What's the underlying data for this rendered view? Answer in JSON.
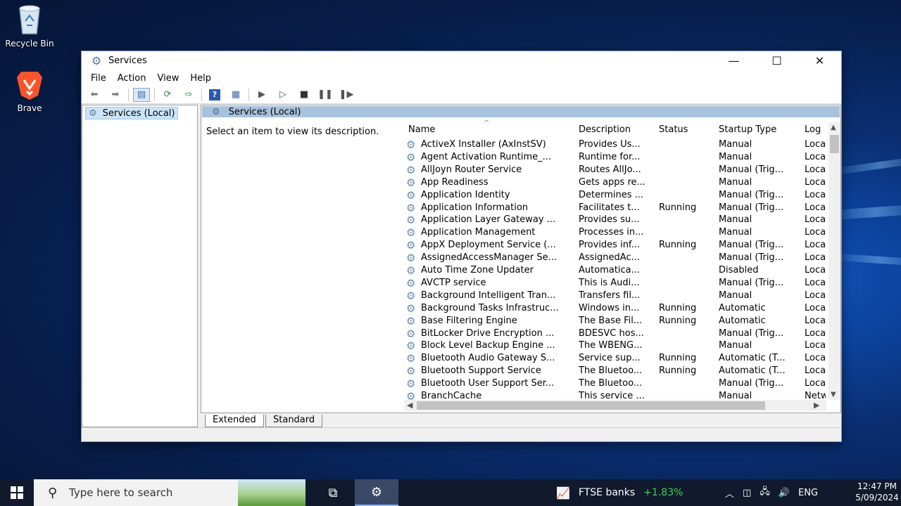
{
  "desktop": {
    "icons": [
      {
        "label": "Recycle Bin",
        "icon": "recycle-bin-icon"
      },
      {
        "label": "Brave",
        "icon": "brave-icon"
      }
    ]
  },
  "window": {
    "title": "Services",
    "menu": [
      "File",
      "Action",
      "View",
      "Help"
    ],
    "tree_item": "Services (Local)",
    "pane_header": "Services (Local)",
    "description_prompt": "Select an item to view its description.",
    "columns": [
      "Name",
      "Description",
      "Status",
      "Startup Type",
      "Log"
    ],
    "services": [
      {
        "name": "ActiveX Installer (AxInstSV)",
        "desc": "Provides Us...",
        "status": "",
        "startup": "Manual",
        "log": "Loca"
      },
      {
        "name": "Agent Activation Runtime_...",
        "desc": "Runtime for...",
        "status": "",
        "startup": "Manual",
        "log": "Loca"
      },
      {
        "name": "AllJoyn Router Service",
        "desc": "Routes AllJo...",
        "status": "",
        "startup": "Manual (Trig...",
        "log": "Loca"
      },
      {
        "name": "App Readiness",
        "desc": "Gets apps re...",
        "status": "",
        "startup": "Manual",
        "log": "Loca"
      },
      {
        "name": "Application Identity",
        "desc": "Determines ...",
        "status": "",
        "startup": "Manual (Trig...",
        "log": "Loca"
      },
      {
        "name": "Application Information",
        "desc": "Facilitates t...",
        "status": "Running",
        "startup": "Manual (Trig...",
        "log": "Loca"
      },
      {
        "name": "Application Layer Gateway ...",
        "desc": "Provides su...",
        "status": "",
        "startup": "Manual",
        "log": "Loca"
      },
      {
        "name": "Application Management",
        "desc": "Processes in...",
        "status": "",
        "startup": "Manual",
        "log": "Loca"
      },
      {
        "name": "AppX Deployment Service (...",
        "desc": "Provides inf...",
        "status": "Running",
        "startup": "Manual (Trig...",
        "log": "Loca"
      },
      {
        "name": "AssignedAccessManager Se...",
        "desc": "AssignedAc...",
        "status": "",
        "startup": "Manual (Trig...",
        "log": "Loca"
      },
      {
        "name": "Auto Time Zone Updater",
        "desc": "Automatica...",
        "status": "",
        "startup": "Disabled",
        "log": "Loca"
      },
      {
        "name": "AVCTP service",
        "desc": "This is Audi...",
        "status": "",
        "startup": "Manual (Trig...",
        "log": "Loca"
      },
      {
        "name": "Background Intelligent Tran...",
        "desc": "Transfers fil...",
        "status": "",
        "startup": "Manual",
        "log": "Loca"
      },
      {
        "name": "Background Tasks Infrastruc...",
        "desc": "Windows in...",
        "status": "Running",
        "startup": "Automatic",
        "log": "Loca"
      },
      {
        "name": "Base Filtering Engine",
        "desc": "The Base Fil...",
        "status": "Running",
        "startup": "Automatic",
        "log": "Loca"
      },
      {
        "name": "BitLocker Drive Encryption ...",
        "desc": "BDESVC hos...",
        "status": "",
        "startup": "Manual (Trig...",
        "log": "Loca"
      },
      {
        "name": "Block Level Backup Engine ...",
        "desc": "The WBENG...",
        "status": "",
        "startup": "Manual",
        "log": "Loca"
      },
      {
        "name": "Bluetooth Audio Gateway S...",
        "desc": "Service sup...",
        "status": "Running",
        "startup": "Automatic (T...",
        "log": "Loca"
      },
      {
        "name": "Bluetooth Support Service",
        "desc": "The Bluetoo...",
        "status": "Running",
        "startup": "Automatic (T...",
        "log": "Loca"
      },
      {
        "name": "Bluetooth User Support Ser...",
        "desc": "The Bluetoo...",
        "status": "",
        "startup": "Manual (Trig...",
        "log": "Loca"
      },
      {
        "name": "BranchCache",
        "desc": "This service ...",
        "status": "",
        "startup": "Manual",
        "log": "Netw"
      }
    ],
    "tabs": [
      "Extended",
      "Standard"
    ]
  },
  "taskbar": {
    "search_placeholder": "Type here to search",
    "ticker_name": "FTSE banks",
    "ticker_change": "+1.83%",
    "language": "ENG",
    "time": "12:47 PM",
    "date": "5/09/2024"
  }
}
